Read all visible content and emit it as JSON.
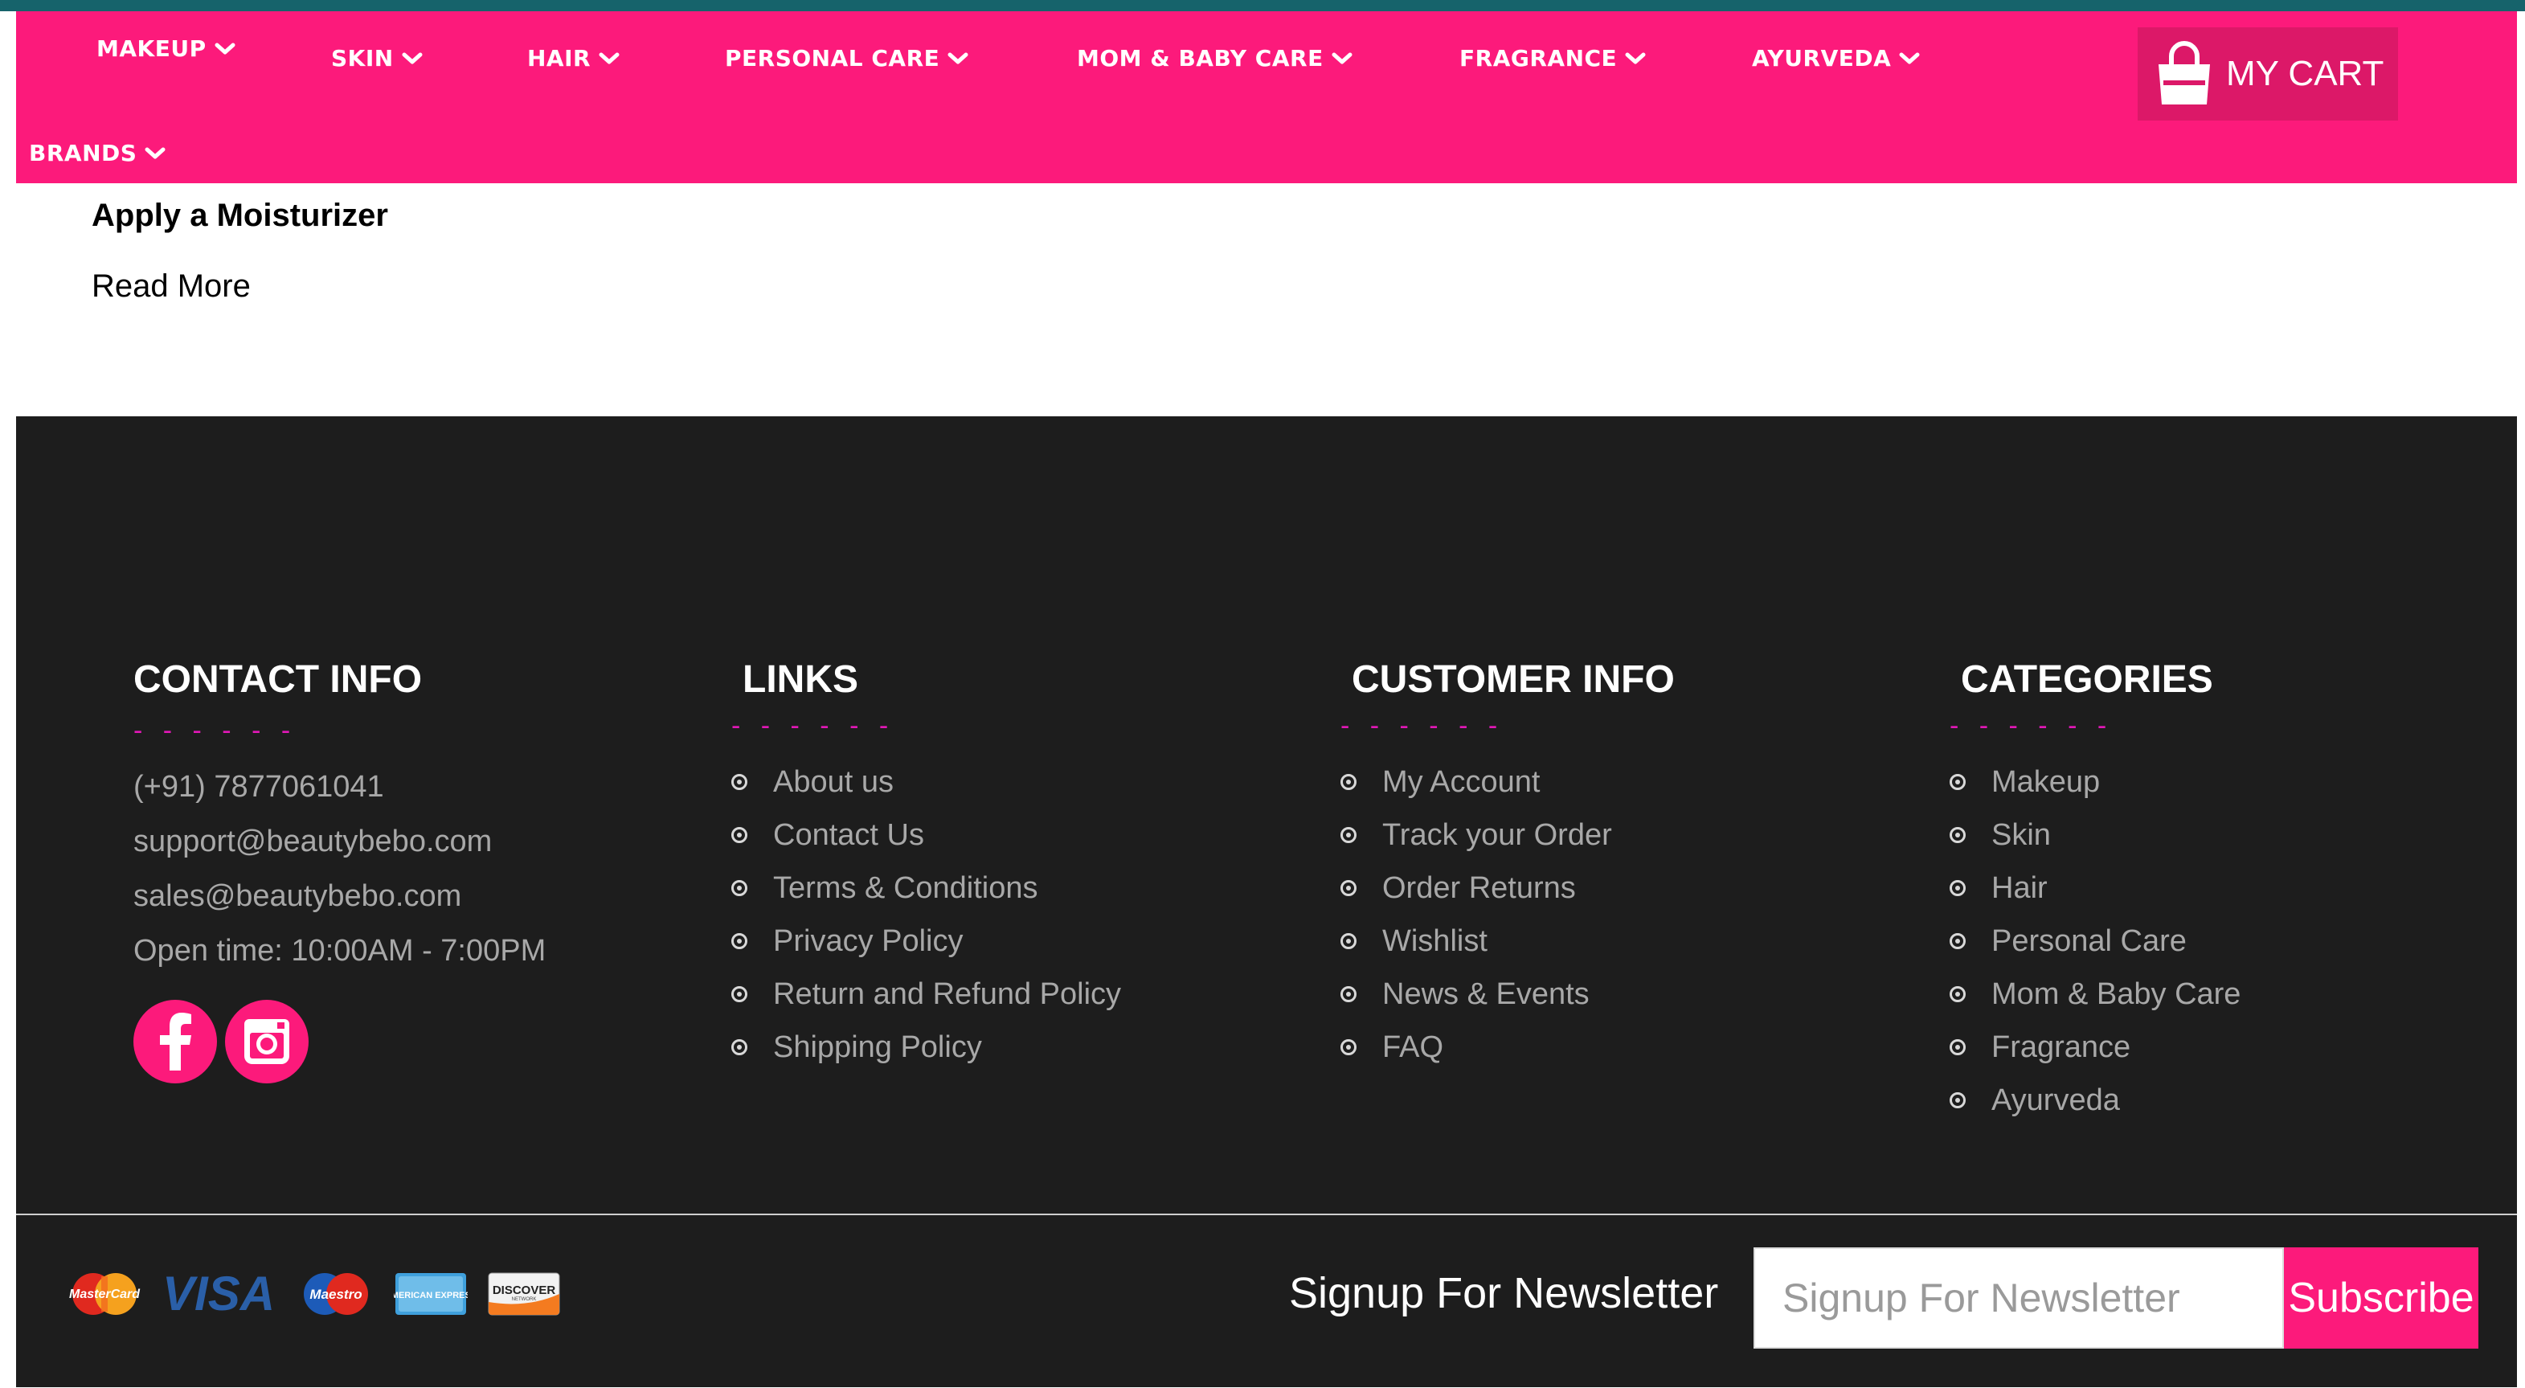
{
  "nav": {
    "items": [
      {
        "label": "MAKEUP"
      },
      {
        "label": "SKIN"
      },
      {
        "label": "HAIR"
      },
      {
        "label": "PERSONAL CARE"
      },
      {
        "label": "MOM & BABY CARE"
      },
      {
        "label": "FRAGRANCE"
      },
      {
        "label": "AYURVEDA"
      },
      {
        "label": "BRANDS"
      }
    ],
    "cart_label": "MY CART",
    "cart_icon": "shopping-bag-icon"
  },
  "content": {
    "article_title": "Apply a Moisturizer",
    "read_more": "Read More"
  },
  "footer": {
    "contact": {
      "heading": "CONTACT INFO",
      "dash": "- - - - - -",
      "phone": "(+91) 7877061041",
      "support_email": "support@beautybebo.com",
      "sales_email": "sales@beautybebo.com",
      "open_time": "Open time: 10:00AM - 7:00PM",
      "social_icons": [
        "facebook-icon",
        "instagram-icon"
      ]
    },
    "links": {
      "heading": "LINKS",
      "dash": "- - - - - -",
      "items": [
        "About us",
        "Contact Us",
        "Terms & Conditions",
        "Privacy Policy",
        "Return and Refund Policy",
        "Shipping Policy"
      ]
    },
    "customer_info": {
      "heading": "CUSTOMER INFO",
      "dash": "- - - - - -",
      "items": [
        "My Account",
        "Track your Order",
        "Order Returns",
        "Wishlist",
        "News & Events",
        "FAQ"
      ]
    },
    "categories": {
      "heading": "CATEGORIES",
      "dash": "- - - - - -",
      "items": [
        "Makeup",
        "Skin",
        "Hair",
        "Personal Care",
        "Mom & Baby Care",
        "Fragrance",
        "Ayurveda"
      ]
    }
  },
  "bottom": {
    "payment_cards": [
      {
        "name": "MasterCard",
        "icon": "mastercard-icon"
      },
      {
        "name": "VISA",
        "icon": "visa-icon"
      },
      {
        "name": "Maestro",
        "icon": "maestro-icon"
      },
      {
        "name": "AMERICAN EXPRESS",
        "icon": "amex-icon"
      },
      {
        "name": "DISCOVER",
        "sub": "NETWORK",
        "icon": "discover-icon"
      }
    ],
    "newsletter_label": "Signup For Newsletter",
    "newsletter_placeholder": "Signup For Newsletter",
    "subscribe_label": "Subscribe"
  },
  "colors": {
    "brand_pink": "#fc1a7b",
    "cart_pink": "#dc1868",
    "footer_bg": "#1d1d1d",
    "accent_magenta": "#e018b6",
    "top_line": "#16636b"
  }
}
